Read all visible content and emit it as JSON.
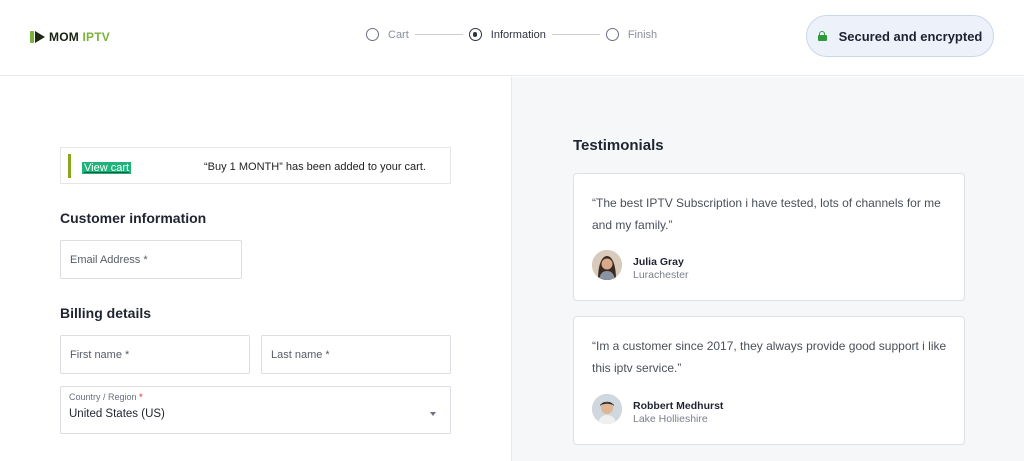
{
  "header": {
    "logo": {
      "prefix": "MOM",
      "accent": "IPTV"
    },
    "steps": [
      {
        "label": "Cart",
        "state": "inactive"
      },
      {
        "label": "Information",
        "state": "active"
      },
      {
        "label": "Finish",
        "state": "inactive"
      }
    ],
    "secure_badge": {
      "label": "Secured and encrypted",
      "icon": "lock-icon",
      "color": "#2e9a3c"
    }
  },
  "notice": {
    "link_label": "View cart",
    "message": "“Buy 1 MONTH” has been added to your cart."
  },
  "customer_info": {
    "title": "Customer information",
    "email_placeholder": "Email Address *"
  },
  "billing": {
    "title": "Billing details",
    "first_name_placeholder": "First name *",
    "last_name_placeholder": "Last name *",
    "country_label": "Country / Region",
    "country_required": "*",
    "country_value": "United States (US)"
  },
  "testimonials": {
    "title": "Testimonials",
    "items": [
      {
        "quote": "“The best IPTV Subscription i have tested, lots of channels for me and my family.”",
        "name": "Julia Gray",
        "location": "Lurachester"
      },
      {
        "quote": "“Im a customer since 2017, they always provide good support i like this iptv service.”",
        "name": "Robbert Medhurst",
        "location": "Lake Hollieshire"
      }
    ]
  },
  "colors": {
    "accent_green": "#7ab23a",
    "link_bg": "#1fb27a",
    "badge_bg": "#edf2fa",
    "panel_bg": "#f5f7f9"
  }
}
